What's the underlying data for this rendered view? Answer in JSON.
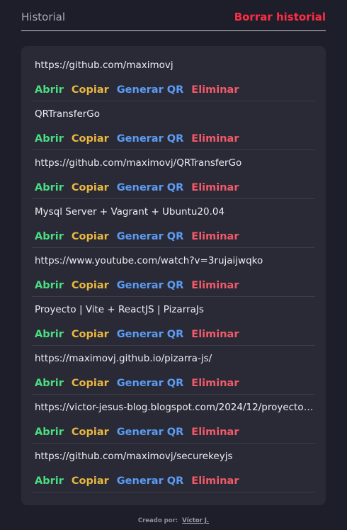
{
  "header": {
    "title": "Historial",
    "clear_label": "Borrar historial"
  },
  "actions": {
    "open": "Abrir",
    "copy": "Copiar",
    "qr": "Generar QR",
    "delete": "Eliminar"
  },
  "items": [
    {
      "text": "https://github.com/maximovj"
    },
    {
      "text": "QRTransferGo"
    },
    {
      "text": "https://github.com/maximovj/QRTransferGo"
    },
    {
      "text": "Mysql Server + Vagrant + Ubuntu20.04"
    },
    {
      "text": "https://www.youtube.com/watch?v=3rujaijwqko"
    },
    {
      "text": "Proyecto | Vite + ReactJS | PizarraJs"
    },
    {
      "text": "https://maximovj.github.io/pizarra-js/"
    },
    {
      "text": "https://victor-jesus-blog.blogspot.com/2024/12/proyecto-..."
    },
    {
      "text": "https://github.com/maximovj/securekeyjs"
    }
  ],
  "footer": {
    "label": "Creado por:",
    "author": "Víctor J."
  },
  "colors": {
    "background": "#1e1e2a",
    "panel": "#2a2a37",
    "clear": "#ff2d43",
    "open": "#4ade80",
    "copy": "#eab83f",
    "qr": "#5b9cf4",
    "delete": "#f25a68"
  }
}
